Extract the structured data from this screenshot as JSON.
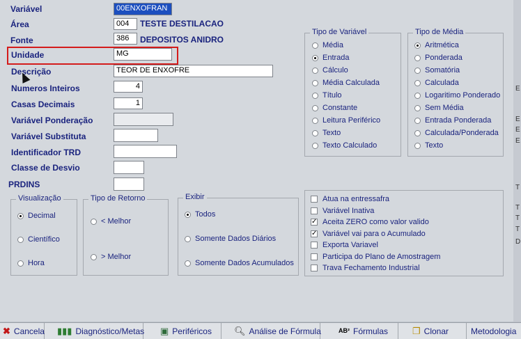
{
  "fields": {
    "variavel": {
      "label": "Variável",
      "value": "00ENXOFRAN"
    },
    "area": {
      "label": "Área",
      "code": "004",
      "name": "TESTE DESTILACAO"
    },
    "fonte": {
      "label": "Fonte",
      "code": "386",
      "name": "DEPOSITOS ANIDRO"
    },
    "unidade": {
      "label": "Unidade",
      "value": "MG"
    },
    "descricao": {
      "label": "Descrição",
      "value": "TEOR DE ENXOFRE"
    },
    "numeros_inteiros": {
      "label": "Numeros Inteiros",
      "value": "4"
    },
    "casas_decimais": {
      "label": "Casas Decimais",
      "value": "1"
    },
    "variavel_ponderacao": {
      "label": "Variável  Ponderação",
      "value": ""
    },
    "variavel_substituta": {
      "label": "Variável  Substituta",
      "value": ""
    },
    "identificador_trd": {
      "label": "Identificador TRD",
      "value": ""
    },
    "classe_desvio": {
      "label": "Classe de Desvio",
      "value": ""
    },
    "prdins": {
      "label": "PRDINS",
      "value": ""
    }
  },
  "tipo_variavel": {
    "title": "Tipo de Variável",
    "options": [
      "Média",
      "Entrada",
      "Cálculo",
      "Média Calculada",
      "Título",
      "Constante",
      "Leitura Periférico",
      "Texto",
      "Texto Calculado"
    ],
    "selected": "Entrada"
  },
  "tipo_media": {
    "title": "Tipo de Média",
    "options": [
      "Aritmética",
      "Ponderada",
      "Somatória",
      "Calculada",
      "Logaritimo Ponderado",
      "Sem Média",
      "Entrada Ponderada",
      "Calculada/Ponderada",
      "Texto"
    ],
    "selected": "Aritmética"
  },
  "visualizacao": {
    "title": "Visualização",
    "options": [
      "Decimal",
      "Científico",
      "Hora"
    ],
    "selected": "Decimal"
  },
  "tipo_retorno": {
    "title": "Tipo de Retorno",
    "options": [
      "< Melhor",
      "> Melhor"
    ],
    "selected": ""
  },
  "exibir": {
    "title": "Exibir",
    "options": [
      "Todos",
      "Somente Dados Diários",
      "Somente Dados Acumulados"
    ],
    "selected": "Todos"
  },
  "flags": [
    {
      "label": "Atua na entressafra",
      "checked": false
    },
    {
      "label": "Variável Inativa",
      "checked": false
    },
    {
      "label": "Aceita ZERO como valor valido",
      "checked": true
    },
    {
      "label": "Variável vai para o Acumulado",
      "checked": true
    },
    {
      "label": "Exporta Variavel",
      "checked": false
    },
    {
      "label": "Participa do Plano de Amostragem",
      "checked": false
    },
    {
      "label": "Trava Fechamento Industrial",
      "checked": false
    }
  ],
  "toolbar": {
    "cancela": "Cancela",
    "diagnostico": "Diagnóstico/Metas",
    "perifericos": "Periféricos",
    "analise": "Análise de Fórmula",
    "formulas": "Fórmulas",
    "formulas_icon_text": "AB²",
    "clonar": "Clonar",
    "metodologia": "Metodologia"
  },
  "right_strip_chars": [
    "E",
    "E",
    "E",
    "E",
    "T",
    "T",
    "T",
    "T",
    "D"
  ],
  "colors": {
    "panel": "#d4d8dd",
    "label_text": "#1a237e",
    "highlight_border": "#d41b1b",
    "selected_input": "#1c4fbf"
  }
}
